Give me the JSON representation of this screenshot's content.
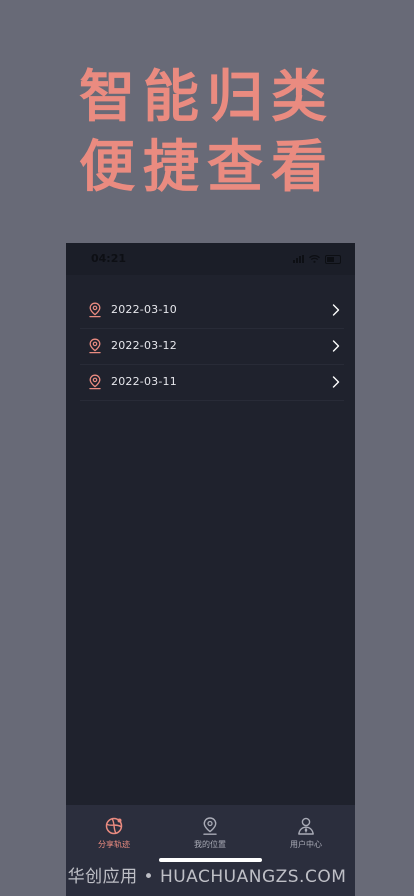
{
  "promo": {
    "line1": "智能归类",
    "line2": "便捷查看"
  },
  "status_bar": {
    "time": "04:21"
  },
  "records": [
    {
      "date": "2022-03-10",
      "icon": "location-pin-icon"
    },
    {
      "date": "2022-03-12",
      "icon": "location-pin-icon"
    },
    {
      "date": "2022-03-11",
      "icon": "location-pin-icon"
    }
  ],
  "tabbar": {
    "tabs": [
      {
        "label": "分享轨迹",
        "icon": "share-track-icon",
        "active": true
      },
      {
        "label": "我的位置",
        "icon": "my-location-icon",
        "active": false
      },
      {
        "label": "用户中心",
        "icon": "user-center-icon",
        "active": false
      }
    ]
  },
  "watermark": "华创应用 • HUACHUANGZS.COM",
  "colors": {
    "background": "#686a77",
    "accent": "#ea8b80",
    "phone_bg": "#1f222d",
    "tabbar_bg": "#2b2e3d"
  }
}
